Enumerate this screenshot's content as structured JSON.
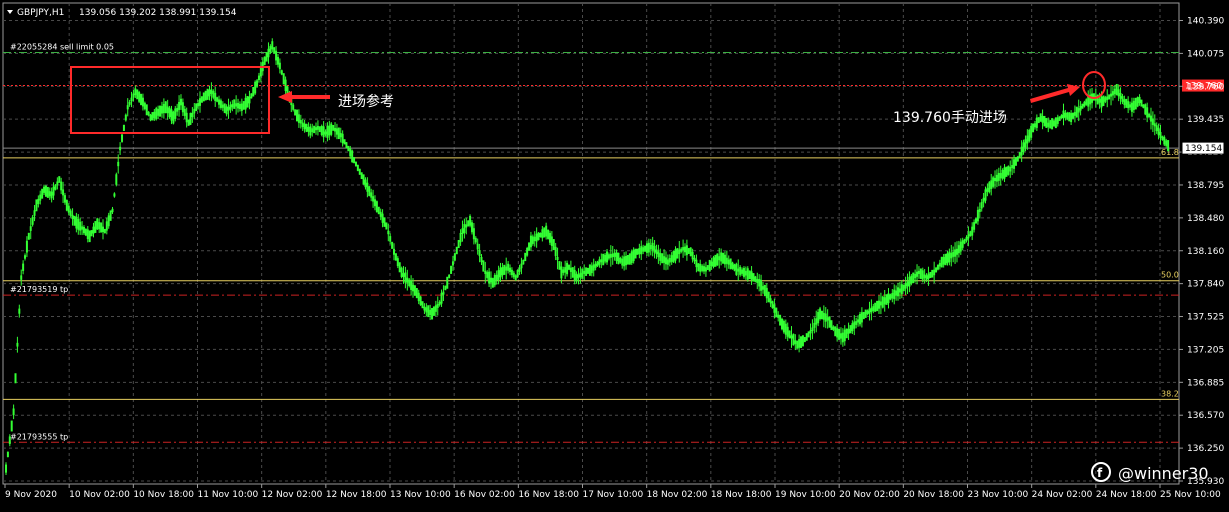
{
  "header": {
    "symbol_timeframe": "GBPJPY,H1",
    "ohlc": "139.056 139.202 138.991 139.154"
  },
  "order_lines": [
    {
      "label": "#22055284 sell limit 0.05",
      "price": 140.08,
      "color": "#3cb043",
      "style": "dashdot"
    },
    {
      "label": "#21793519 tp",
      "price": 137.73,
      "color": "#cc2222",
      "style": "dashdot"
    },
    {
      "label": "#21793555 tp",
      "price": 136.305,
      "color": "#cc2222",
      "style": "dashdot"
    }
  ],
  "price_lines": [
    {
      "price": 139.76,
      "label": "139.760",
      "color": "#ff2a2a",
      "style": "dotted"
    }
  ],
  "fib_levels": [
    {
      "label": "61.8",
      "price": 139.06
    },
    {
      "label": "50.0",
      "price": 137.87
    },
    {
      "label": "38.2",
      "price": 136.72
    }
  ],
  "current_price": {
    "value": "139.154",
    "price": 139.154
  },
  "annotations": {
    "entry_reference": "进场参考",
    "manual_entry": "139.760手动进场"
  },
  "watermark": "@winner30",
  "colors": {
    "background": "#000000",
    "candles": "#33ff33",
    "grid": "#4a4a4a",
    "annotation": "#ff2a2a"
  },
  "chart_data": {
    "type": "line",
    "title": "GBPJPY,H1",
    "xlabel": "",
    "ylabel": "",
    "y_ticks": [
      "140.390",
      "140.075",
      "139.760",
      "139.435",
      "139.120",
      "138.795",
      "138.480",
      "138.160",
      "137.840",
      "137.525",
      "137.205",
      "136.885",
      "136.570",
      "136.250",
      "135.930"
    ],
    "x_ticks": [
      "9 Nov 2020",
      "10 Nov 02:00",
      "10 Nov 18:00",
      "11 Nov 10:00",
      "12 Nov 02:00",
      "12 Nov 18:00",
      "13 Nov 10:00",
      "16 Nov 02:00",
      "16 Nov 18:00",
      "17 Nov 10:00",
      "18 Nov 02:00",
      "18 Nov 18:00",
      "19 Nov 10:00",
      "20 Nov 02:00",
      "20 Nov 18:00",
      "23 Nov 10:00",
      "24 Nov 02:00",
      "24 Nov 18:00",
      "25 Nov 10:00"
    ],
    "ylim": [
      135.93,
      140.39
    ],
    "grid": true,
    "series": [
      {
        "values": [
          136.05,
          136.6,
          137.9,
          138.3,
          138.6,
          138.75,
          138.7,
          138.85,
          138.6,
          138.45,
          138.38,
          138.3,
          138.42,
          138.35,
          138.55,
          139.15,
          139.55,
          139.7,
          139.6,
          139.45,
          139.5,
          139.55,
          139.45,
          139.6,
          139.4,
          139.55,
          139.65,
          139.7,
          139.6,
          139.52,
          139.58,
          139.55,
          139.62,
          139.78,
          140.0,
          140.15,
          139.95,
          139.7,
          139.5,
          139.38,
          139.32,
          139.35,
          139.3,
          139.35,
          139.28,
          139.15,
          139.0,
          138.85,
          138.7,
          138.55,
          138.4,
          138.15,
          137.95,
          137.85,
          137.75,
          137.6,
          137.55,
          137.65,
          137.85,
          138.1,
          138.35,
          138.45,
          138.2,
          137.95,
          137.85,
          137.95,
          138.0,
          137.9,
          138.05,
          138.25,
          138.3,
          138.35,
          138.22,
          137.95,
          138.0,
          137.9,
          137.95,
          137.98,
          138.05,
          138.1,
          138.12,
          138.05,
          138.08,
          138.15,
          138.18,
          138.2,
          138.1,
          138.05,
          138.12,
          138.18,
          138.15,
          138.0,
          137.98,
          138.05,
          138.1,
          138.05,
          137.98,
          137.95,
          137.92,
          137.85,
          137.75,
          137.6,
          137.45,
          137.35,
          137.25,
          137.3,
          137.4,
          137.55,
          137.5,
          137.38,
          137.32,
          137.4,
          137.48,
          137.55,
          137.6,
          137.65,
          137.7,
          137.75,
          137.8,
          137.88,
          137.95,
          137.9,
          137.95,
          138.05,
          138.1,
          138.15,
          138.25,
          138.35,
          138.55,
          138.75,
          138.85,
          138.9,
          138.95,
          139.05,
          139.2,
          139.35,
          139.45,
          139.38,
          139.4,
          139.48,
          139.45,
          139.52,
          139.6,
          139.65,
          139.6,
          139.65,
          139.72,
          139.6,
          139.55,
          139.62,
          139.5,
          139.38,
          139.25,
          139.154
        ]
      }
    ]
  }
}
